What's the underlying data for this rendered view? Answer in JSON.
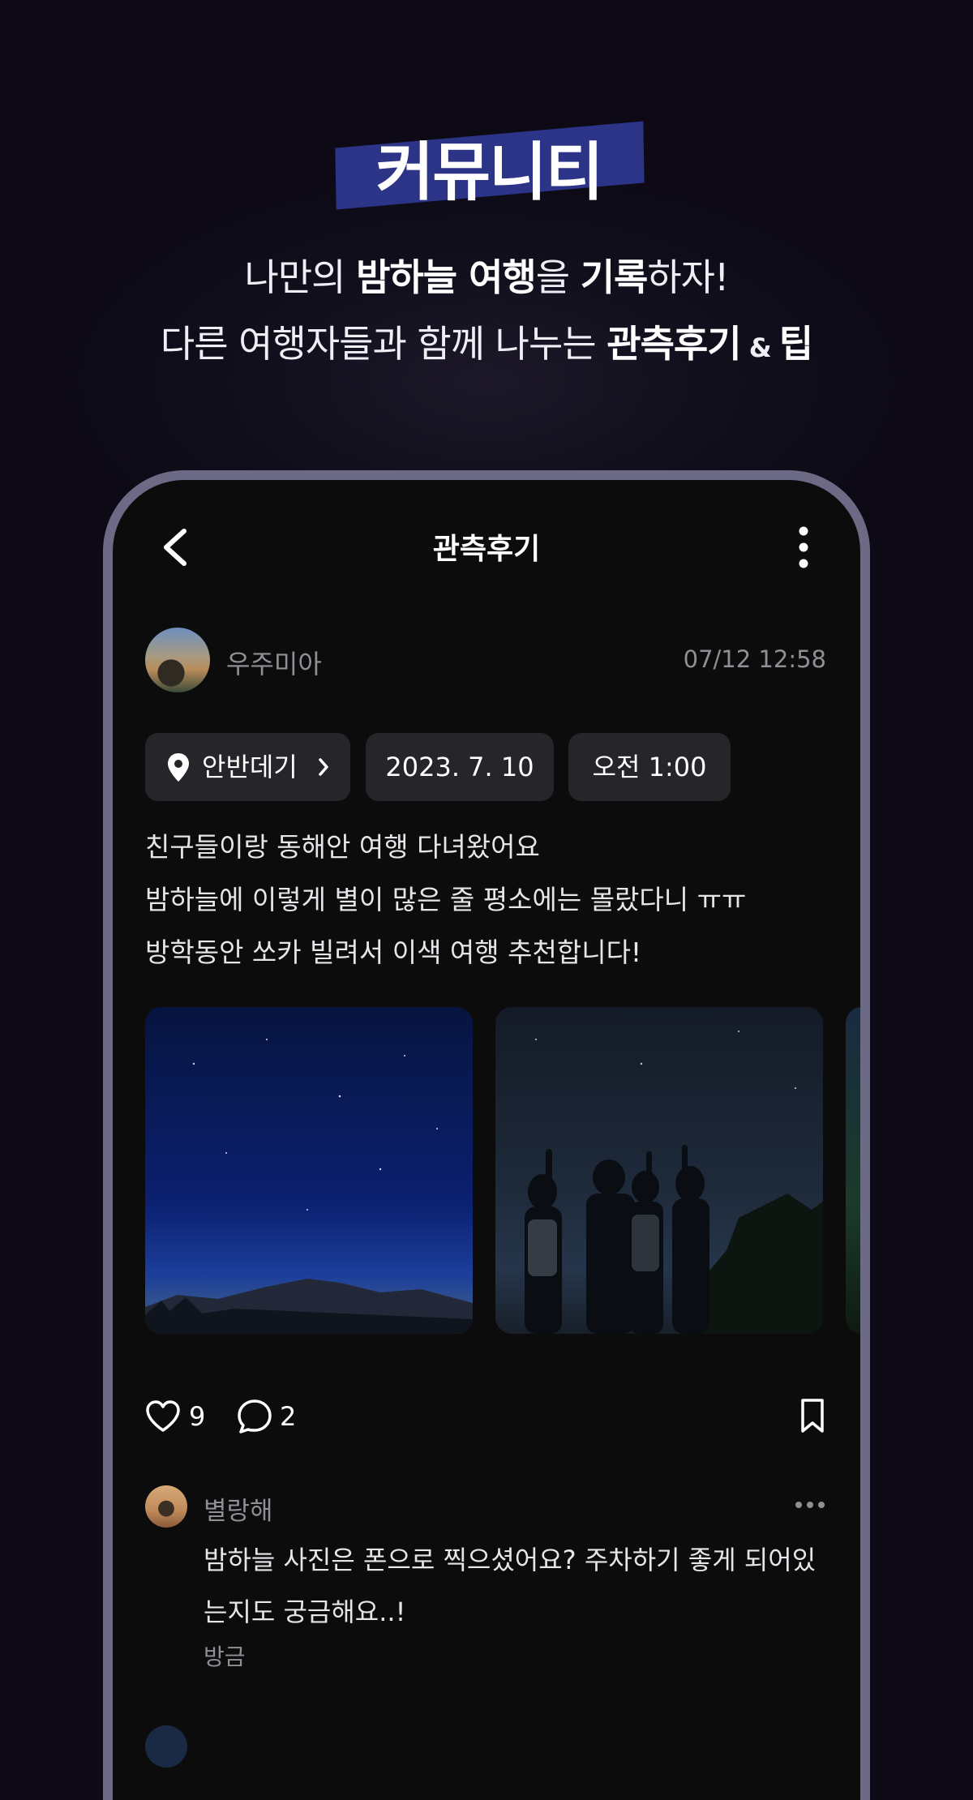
{
  "headline": {
    "title": "커뮤니티",
    "line1": {
      "p1": "나만의 ",
      "b1": "밤하늘 여행",
      "p2": "을 ",
      "b2": "기록",
      "p3": "하자!"
    },
    "line2": {
      "p1": "다른 여행자들과 함께 나누는 ",
      "b1": "관측후기",
      "amp": " & ",
      "b2": "팁"
    }
  },
  "screen": {
    "nav": {
      "title": "관측후기",
      "back_icon": "back-chevron-icon",
      "more_icon": "more-vertical-icon"
    },
    "post": {
      "author": "우주미아",
      "timestamp": "07/12 12:58",
      "chips": {
        "location": "안반데기",
        "date": "2023. 7. 10",
        "time": "오전 1:00"
      },
      "body": [
        "친구들이랑 동해안 여행 다녀왔어요",
        "밤하늘에 이렇게 별이 많은 줄 평소에는 몰랐다니 ㅠㅠ",
        "방학동안 쏘카 빌려서 이색 여행 추천합니다!"
      ],
      "likes": "9",
      "comments": "2"
    },
    "comment": {
      "author": "별랑해",
      "lines": [
        "밤하늘 사진은 폰으로 찍으셨어요? 주차하기 좋게 되어있",
        "는지도 궁금해요..!"
      ],
      "time": "방금"
    }
  },
  "colors": {
    "highlight": "#2b3487",
    "frame": "#6d6a86",
    "chip": "#25252a",
    "muted": "#8f8f96"
  }
}
